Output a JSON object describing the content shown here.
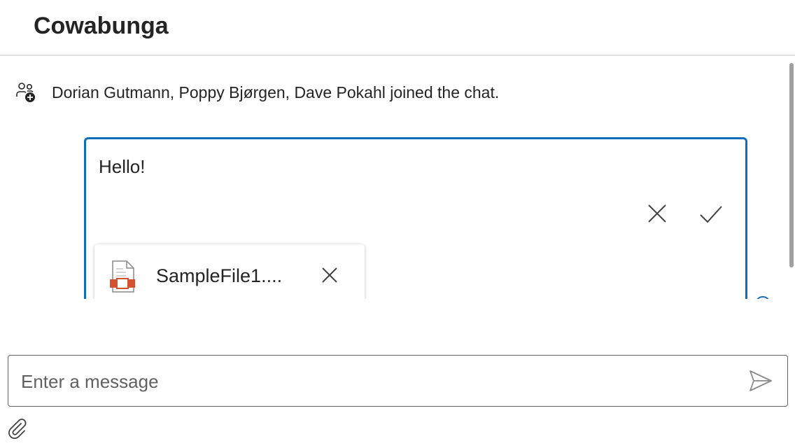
{
  "header": {
    "title": "Cowabunga"
  },
  "messages": {
    "system_text": "Dorian Gutmann, Poppy Bjørgen, Dave Pokahl joined the chat.",
    "system_icon": "people-add-icon"
  },
  "edit": {
    "text": "Hello!",
    "cancel_icon": "close-icon",
    "confirm_icon": "checkmark-icon"
  },
  "attachment": {
    "file_name": "SampleFile1....",
    "file_icon": "powerpoint-file-icon",
    "remove_icon": "close-icon"
  },
  "compose": {
    "placeholder": "Enter a message",
    "value": "",
    "send_icon": "send-icon",
    "attach_icon": "paperclip-icon"
  },
  "colors": {
    "accent": "#0f6cbd",
    "text": "#242424",
    "file_accent": "#d35230"
  }
}
